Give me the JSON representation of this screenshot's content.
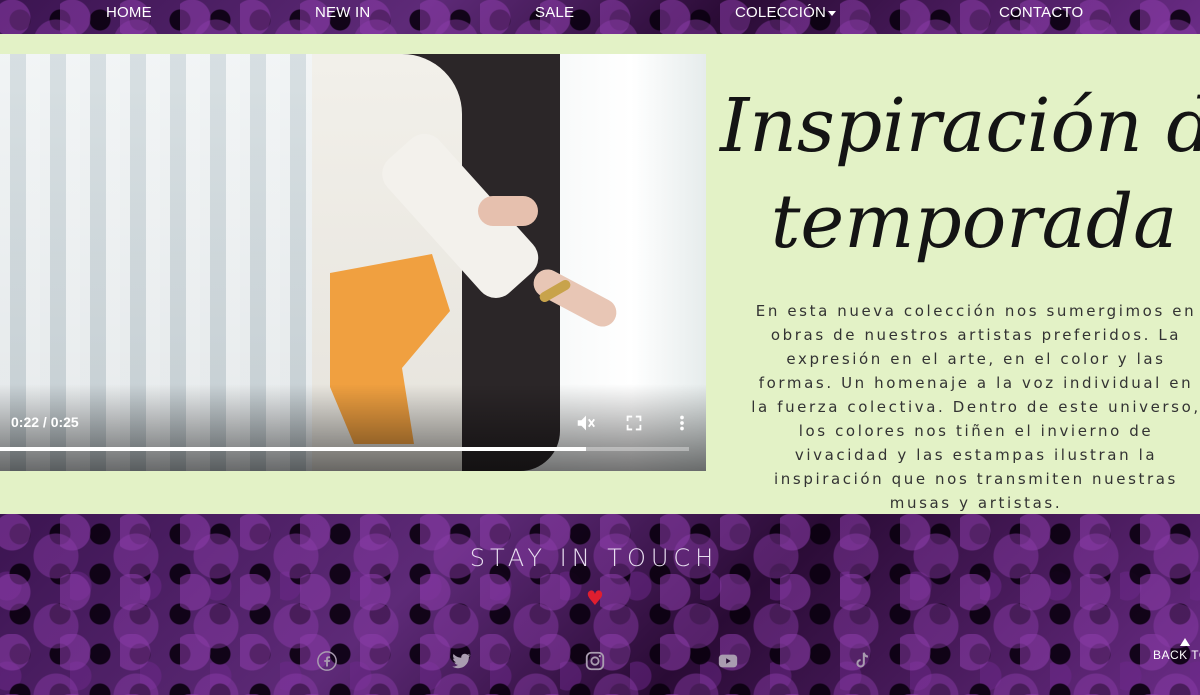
{
  "nav": {
    "items": [
      {
        "label": "HOME"
      },
      {
        "label": "NEW IN"
      },
      {
        "label": "SALE"
      },
      {
        "label": "COLECCIÓN"
      },
      {
        "label": "CONTACTO"
      }
    ]
  },
  "video": {
    "time": "0:22 / 0:25",
    "progress": 0.85,
    "controls": [
      "mute-icon",
      "fullscreen-icon",
      "more-options-icon"
    ]
  },
  "headline": {
    "line1": "Inspiración de la",
    "line2": "temporada"
  },
  "description": "En esta nueva colección nos sumergimos en obras de nuestros artistas preferidos. La expresión en el arte, en el color y las formas. Un homenaje a la voz individual en la fuerza colectiva. Dentro de este universo, los colores nos tiñen el invierno de vivacidad y las estampas ilustran la inspiración que nos transmiten nuestras musas y artistas.",
  "footer": {
    "title": "STAY IN TOUCH",
    "heart": "♥",
    "social": [
      "facebook-icon",
      "twitter-icon",
      "instagram-icon",
      "youtube-icon",
      "tiktok-icon"
    ],
    "back_to_top": "BACK TO TOP"
  },
  "colors": {
    "content_bg": "#e3f2c6",
    "heart": "#e01e2f",
    "footer_bg": "#2a0f37"
  }
}
